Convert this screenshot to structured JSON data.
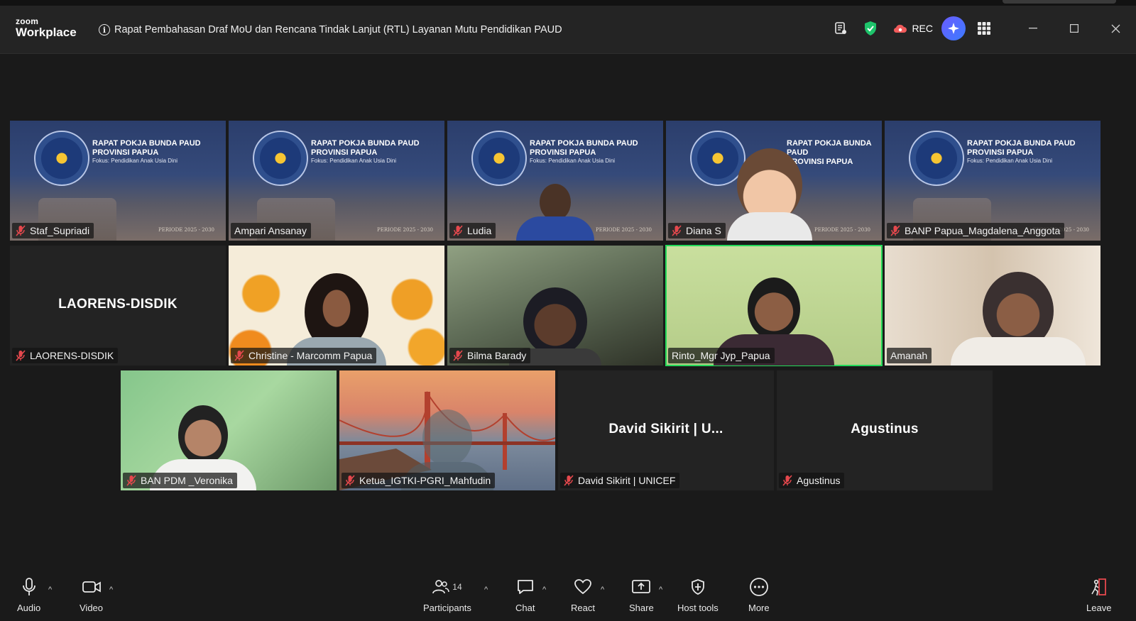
{
  "app": {
    "brand_top": "zoom",
    "brand_bottom": "Workplace"
  },
  "meeting": {
    "title": "Rapat Pembahasan Draf MoU dan Rencana Tindak Lanjut (RTL) Layanan Mutu Pendidikan PAUD"
  },
  "topbar": {
    "rec_label": "REC"
  },
  "slide": {
    "title_line1": "RAPAT POKJA BUNDA PAUD",
    "title_line2": "PROVINSI PAPUA",
    "subtitle": "Fokus: Pendidikan Anak Usia Dini",
    "period": "PERIODE 2025 - 2030"
  },
  "participants": [
    {
      "name": "Staf_Supriadi",
      "muted": true
    },
    {
      "name": "Ampari Ansanay",
      "muted": false
    },
    {
      "name": "Ludia",
      "muted": true
    },
    {
      "name": "Diana S",
      "muted": true
    },
    {
      "name": "BANP Papua_Magdalena_Anggota",
      "muted": true
    },
    {
      "name": "LAORENS-DISDIK",
      "muted": true,
      "display_name": "LAORENS-DISDIK"
    },
    {
      "name": "Christine - Marcomm Papua",
      "muted": true
    },
    {
      "name": "Bilma Barady",
      "muted": true
    },
    {
      "name": "Rinto_Mgr Jyp_Papua",
      "muted": false,
      "active_speaker": true
    },
    {
      "name": "Amanah",
      "muted": false
    },
    {
      "name": "BAN PDM _Veronika",
      "muted": true
    },
    {
      "name": "Ketua_IGTKI-PGRI_Mahfudin",
      "muted": true
    },
    {
      "name": "David Sikirit | UNICEF",
      "muted": true,
      "display_name": "David Sikirit | U..."
    },
    {
      "name": "Agustinus",
      "muted": true,
      "display_name": "Agustinus"
    }
  ],
  "toolbar": {
    "audio": "Audio",
    "video": "Video",
    "participants": "Participants",
    "participants_count": "14",
    "chat": "Chat",
    "react": "React",
    "share": "Share",
    "host_tools": "Host tools",
    "more": "More",
    "leave": "Leave"
  },
  "colors": {
    "active_speaker": "#23d959",
    "leave": "#e5484d",
    "shield": "#1ec46b",
    "rec_cloud": "#f15b5b"
  }
}
